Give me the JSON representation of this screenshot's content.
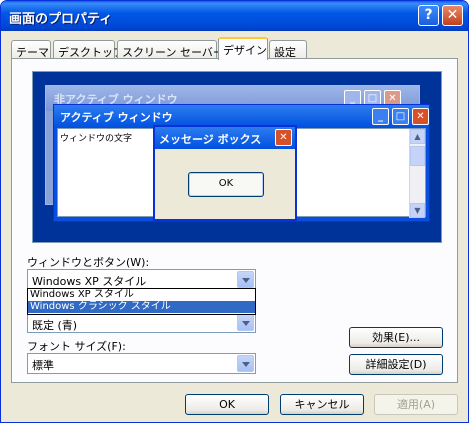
{
  "window": {
    "title": "画面のプロパティ"
  },
  "titlebar": {
    "help_glyph": "?",
    "close_glyph": "✕"
  },
  "tabs": [
    {
      "label": "テーマ"
    },
    {
      "label": "デスクトップ"
    },
    {
      "label": "スクリーン セーバー"
    },
    {
      "label": "デザイン",
      "active": true
    },
    {
      "label": "設定"
    }
  ],
  "preview": {
    "inactive_title": "非アクティブ ウィンドウ",
    "active_title": "アクティブ ウィンドウ",
    "window_text": "ウィンドウの文字",
    "message_title": "メッセージ ボックス",
    "message_ok": "OK"
  },
  "style_section": {
    "label": "ウィンドウとボタン(W):",
    "selected": "Windows XP スタイル",
    "options": [
      "Windows XP スタイル",
      "Windows クラシック スタイル"
    ],
    "highlighted": "Windows クラシック スタイル"
  },
  "color_section": {
    "value": "既定 (青)"
  },
  "font_section": {
    "label": "フォント サイズ(F):",
    "value": "標準"
  },
  "buttons": {
    "effects": "効果(E)...",
    "advanced": "詳細設定(D)",
    "ok": "OK",
    "cancel": "キャンセル",
    "apply": "適用(A)"
  },
  "colors": {
    "accent": "#0831d9",
    "selection": "#316ac5",
    "desktop_blue": "#003399"
  }
}
